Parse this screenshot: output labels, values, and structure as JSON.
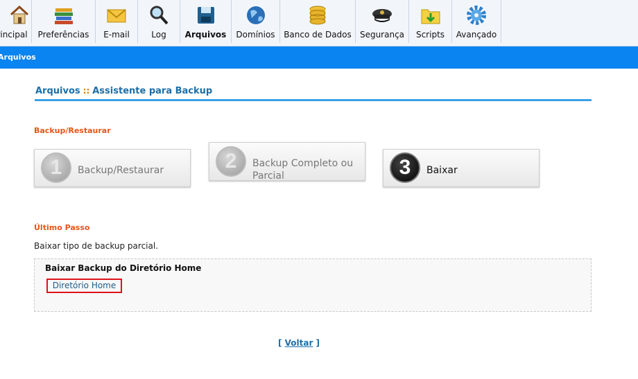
{
  "toolbar": {
    "items": [
      {
        "label": "rincipal",
        "icon": "home-icon"
      },
      {
        "label": "Preferências",
        "icon": "books-icon"
      },
      {
        "label": "E-mail",
        "icon": "envelope-icon"
      },
      {
        "label": "Log",
        "icon": "magnifier-icon"
      },
      {
        "label": "Arquivos",
        "icon": "floppy-disk-icon",
        "active": true
      },
      {
        "label": "Domínios",
        "icon": "globe-icon"
      },
      {
        "label": "Banco de Dados",
        "icon": "database-icon"
      },
      {
        "label": "Segurança",
        "icon": "police-cap-icon"
      },
      {
        "label": "Scripts",
        "icon": "folder-download-icon"
      },
      {
        "label": "Avançado",
        "icon": "gear-icon"
      }
    ]
  },
  "bluebar": {
    "label": "Arquivos"
  },
  "header": {
    "section": "Arquivos",
    "separator": "::",
    "subtitle": "Assistente para Backup"
  },
  "wizard": {
    "section_title": "Backup/Restaurar",
    "steps": [
      {
        "number": "1",
        "label": "Backup/Restaurar",
        "state": "inactive"
      },
      {
        "number": "2",
        "label_line1": "Backup Completo ou",
        "label_line2": "Parcial",
        "state": "inactive"
      },
      {
        "number": "3",
        "label": "Baixar",
        "state": "active"
      }
    ]
  },
  "last_step": {
    "section_title": "Último Passo",
    "description": "Baixar tipo de backup parcial.",
    "box_title": "Baixar Backup do Diretório Home",
    "link_label": "Diretório Home"
  },
  "footer": {
    "back_open": "[ ",
    "back_label": "Voltar",
    "back_close": " ]"
  },
  "colors": {
    "accent": "#0a84f0",
    "section": "#e8541a",
    "link": "#1b6fa8",
    "highlight": "#e0101a"
  }
}
